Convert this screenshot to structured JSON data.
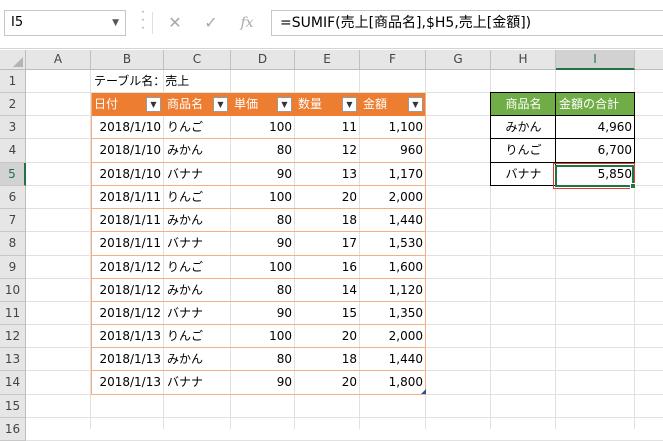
{
  "name_box": "I5",
  "formula_buttons": {
    "cancel": "✕",
    "enter": "✓",
    "function": "fx"
  },
  "formula": "=SUMIF(売上[商品名],$H5,売上[金額])",
  "columns": [
    "A",
    "B",
    "C",
    "D",
    "E",
    "F",
    "G",
    "H",
    "I"
  ],
  "rows": [
    "1",
    "2",
    "3",
    "4",
    "5",
    "6",
    "7",
    "8",
    "9",
    "10",
    "11",
    "12",
    "13",
    "14",
    "15",
    "16"
  ],
  "table_caption": "テーブル名：売上",
  "table": {
    "headers": [
      "日付",
      "商品名",
      "単価",
      "数量",
      "金額"
    ],
    "rows": [
      [
        "2018/1/10",
        "りんご",
        "100",
        "11",
        "1,100"
      ],
      [
        "2018/1/10",
        "みかん",
        "80",
        "12",
        "960"
      ],
      [
        "2018/1/10",
        "バナナ",
        "90",
        "13",
        "1,170"
      ],
      [
        "2018/1/11",
        "りんご",
        "100",
        "20",
        "2,000"
      ],
      [
        "2018/1/11",
        "みかん",
        "80",
        "18",
        "1,440"
      ],
      [
        "2018/1/11",
        "バナナ",
        "90",
        "17",
        "1,530"
      ],
      [
        "2018/1/12",
        "りんご",
        "100",
        "16",
        "1,600"
      ],
      [
        "2018/1/12",
        "みかん",
        "80",
        "14",
        "1,120"
      ],
      [
        "2018/1/12",
        "バナナ",
        "90",
        "15",
        "1,350"
      ],
      [
        "2018/1/13",
        "りんご",
        "100",
        "20",
        "2,000"
      ],
      [
        "2018/1/13",
        "みかん",
        "80",
        "18",
        "1,440"
      ],
      [
        "2018/1/13",
        "バナナ",
        "90",
        "20",
        "1,800"
      ]
    ]
  },
  "summary": {
    "headers": [
      "商品名",
      "金額の合計"
    ],
    "rows": [
      [
        "みかん",
        "4,960"
      ],
      [
        "りんご",
        "6,700"
      ],
      [
        "バナナ",
        "5,850"
      ]
    ]
  },
  "colors": {
    "table_header": "#ed7d31",
    "summary_header": "#70ad47",
    "selection": "#217346",
    "highlight": "#e53935"
  }
}
